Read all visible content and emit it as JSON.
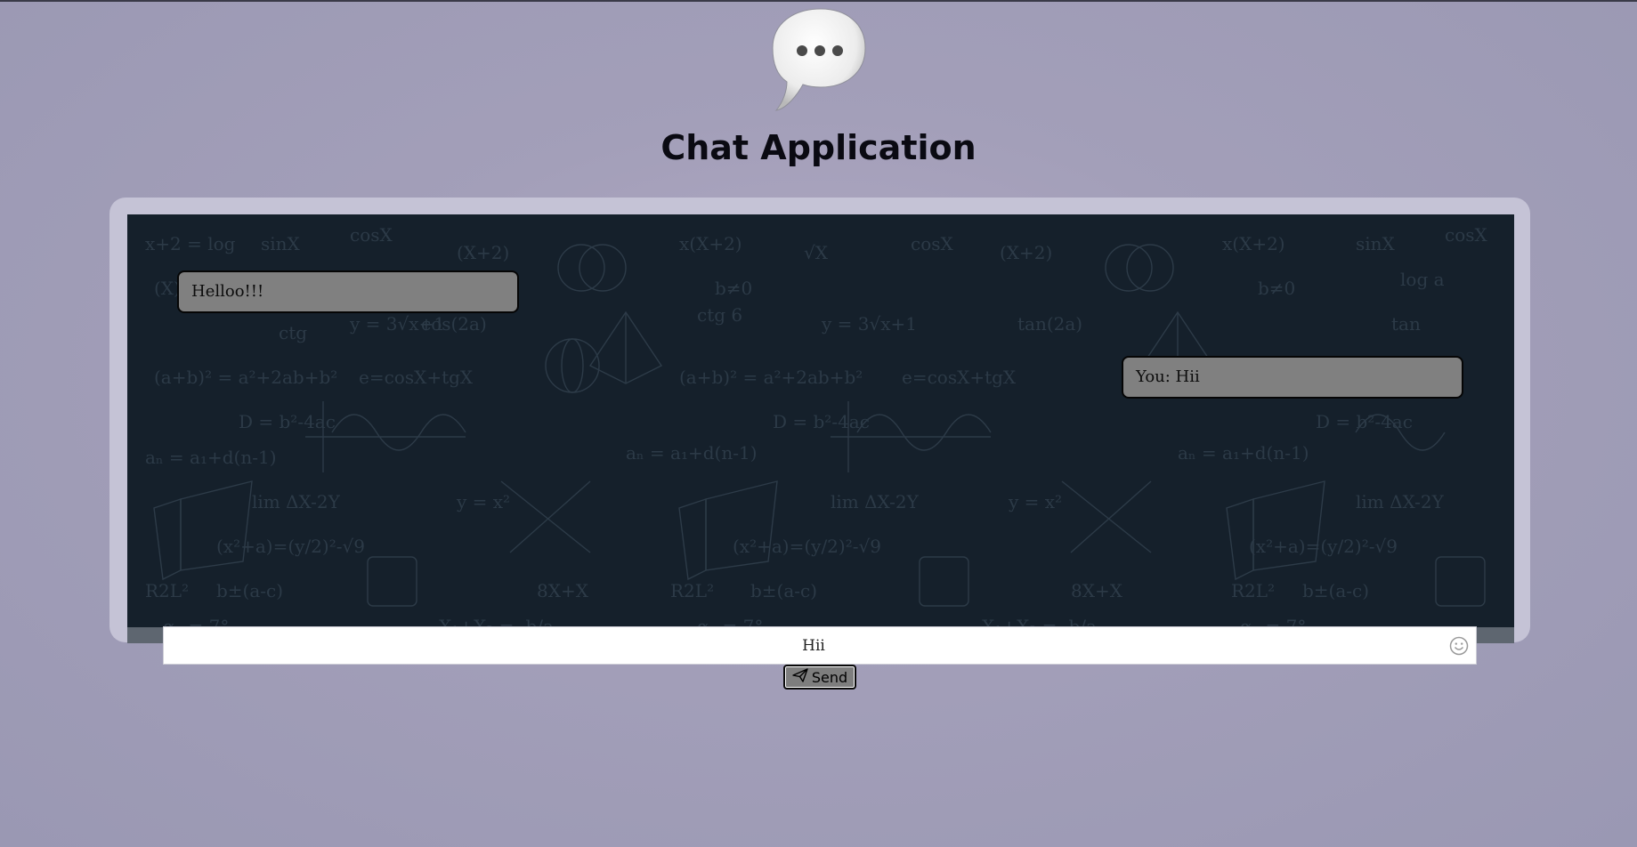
{
  "app": {
    "title": "Chat Application",
    "logo_icon": "speech-bubble-ellipsis-icon"
  },
  "chat": {
    "messages": [
      {
        "direction": "received",
        "text": "Helloo!!!"
      },
      {
        "direction": "sent",
        "text": "You: Hii"
      }
    ]
  },
  "composer": {
    "input_value": "Hii",
    "emoji_icon": "smiley-icon",
    "send_label": "Send",
    "send_icon": "paper-plane-icon"
  },
  "colors": {
    "background": "#a39fb9",
    "chat_background": "#15202b",
    "bubble": "#808080",
    "button": "#7e7e7e"
  }
}
